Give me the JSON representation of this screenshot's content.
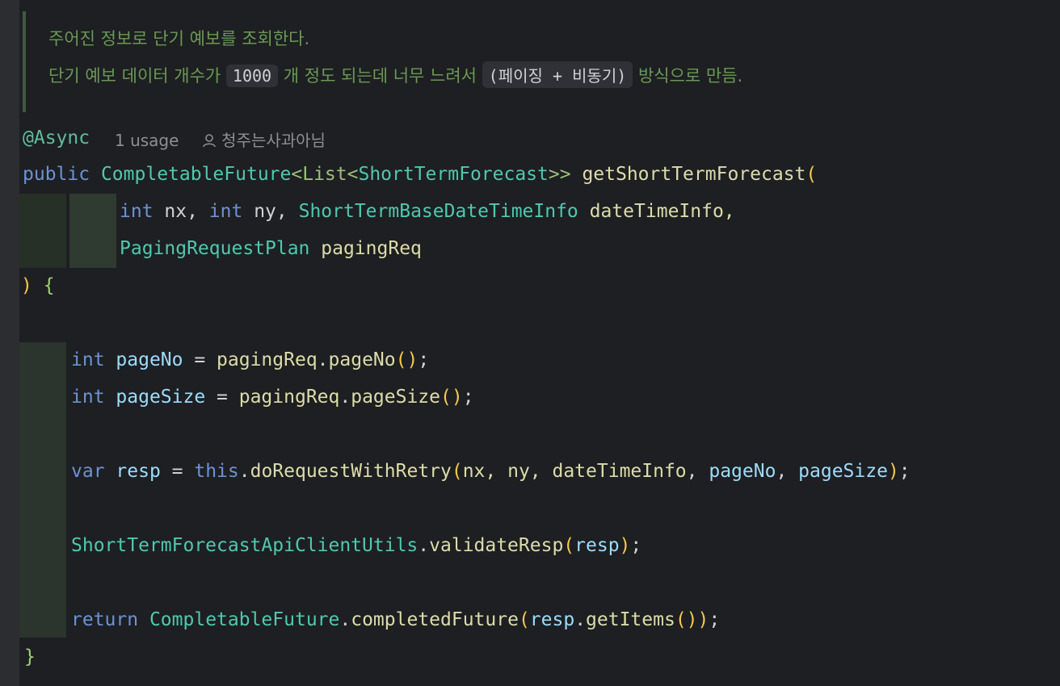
{
  "doc": {
    "line1": "주어진 정보로 단기 예보를 조회한다.",
    "line2_pre": "단기 예보 데이터 개수가 ",
    "code1": "1000",
    "line2_mid": " 개 정도 되는데 너무 느려서 ",
    "code2": "(페이징 + 비동기)",
    "line2_post": " 방식으로 만듬."
  },
  "annotation": "@Async",
  "usage": "1 usage",
  "author": "청주는사과아님",
  "code": {
    "public": "public",
    "ret_type": "CompletableFuture",
    "lt1": "<",
    "list": "List",
    "lt2": "<",
    "elem_type": "ShortTermForecast",
    "gt": ">>",
    "method": "getShortTermForecast",
    "paren_open": "(",
    "int1": "int",
    "nx": "nx, ",
    "int2": "int",
    "ny": "ny, ",
    "dt_type": "ShortTermBaseDateTimeInfo",
    "dt_name": "dateTimeInfo,",
    "pr_type": "PagingRequestPlan",
    "pr_name": "pagingReq",
    "close_paren": ")",
    "open_brace": "{",
    "int3": "int",
    "pageNo_var": "pageNo",
    "eq1": " = ",
    "pagingReq1": "pagingReq",
    "dot1": ".",
    "pageNo_call": "pageNo",
    "call1": "()",
    "semi1": ";",
    "int4": "int",
    "pageSize_var": "pageSize",
    "eq2": " = ",
    "pagingReq2": "pagingReq",
    "dot2": ".",
    "pageSize_call": "pageSize",
    "call2": "()",
    "semi2": ";",
    "var_kw": "var",
    "resp_var": "resp",
    "eq3": " = ",
    "this_kw": "this",
    "dot3": ".",
    "doRequest": "doRequestWithRetry",
    "p3o": "(",
    "args_plain": "nx, ny, ",
    "arg_dt": "dateTimeInfo",
    "comma1": ", ",
    "arg_pageNo": "pageNo",
    "comma2": ", ",
    "arg_pageSize": "pageSize",
    "p3c": ")",
    "semi3": ";",
    "utils": "ShortTermForecastApiClientUtils",
    "dot4": ".",
    "validate": "validateResp",
    "p4o": "(",
    "resp_arg": "resp",
    "p4c": ")",
    "semi4": ";",
    "return_kw": "return",
    "cf": "CompletableFuture",
    "dot5": ".",
    "completed": "completedFuture",
    "p5o": "(",
    "resp2": "resp",
    "dot6": ".",
    "getItems": "getItems",
    "p6": "()",
    "p5c": ")",
    "semi5": ";",
    "close_brace": "}"
  }
}
